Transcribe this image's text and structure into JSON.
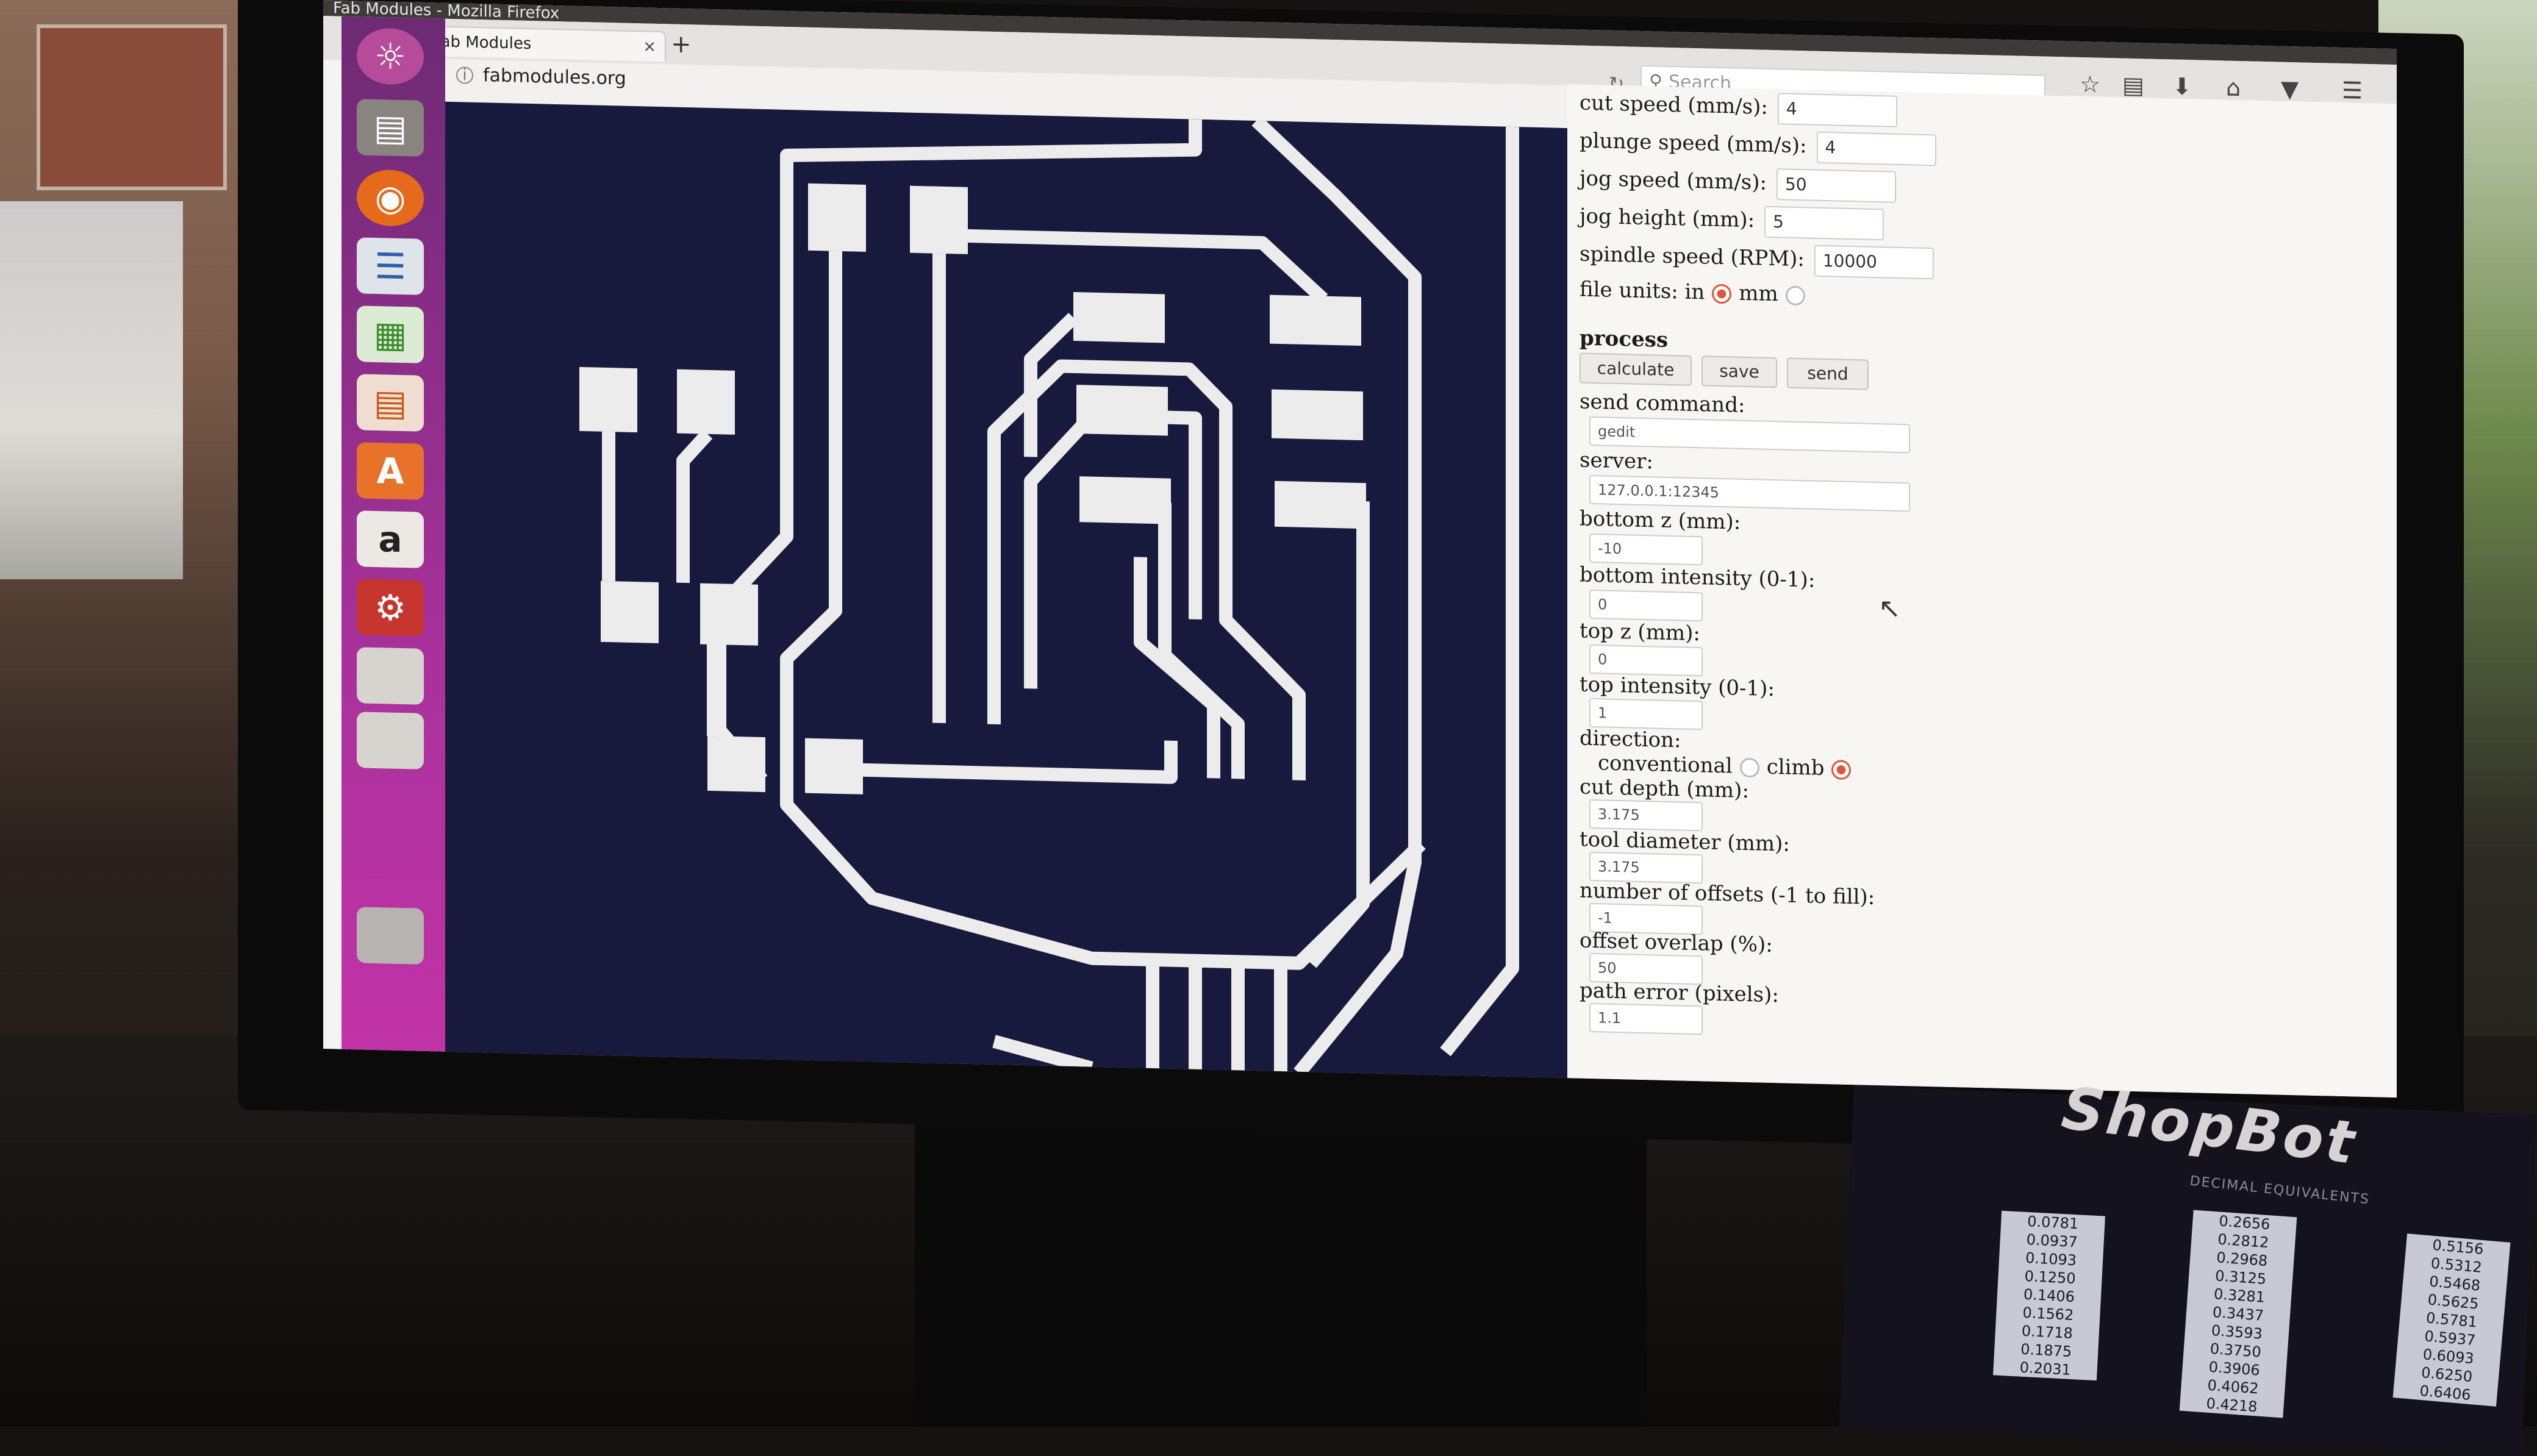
{
  "window": {
    "title_bar": "Fab Modules - Mozilla Firefox",
    "tab_label": "Fab Modules",
    "tab_close": "×",
    "new_tab": "+",
    "url": "fabmodules.org",
    "search_placeholder": "Search"
  },
  "form": {
    "cut_speed_label": "cut speed (mm/s):",
    "cut_speed": "4",
    "plunge_speed_label": "plunge speed (mm/s):",
    "plunge_speed": "4",
    "jog_speed_label": "jog speed (mm/s):",
    "jog_speed": "50",
    "jog_height_label": "jog height (mm):",
    "jog_height": "5",
    "spindle_speed_label": "spindle speed (RPM):",
    "spindle_speed": "10000",
    "file_units_label": "file units: in",
    "file_units_mm": "mm",
    "process_heading": "process",
    "calculate_label": "calculate",
    "save_label": "save",
    "send_label": "send",
    "send_command_label": "send command:",
    "send_command": "gedit",
    "server_label": "server:",
    "server": "127.0.0.1:12345",
    "bottom_z_label": "bottom z (mm):",
    "bottom_z": "-10",
    "bottom_intensity_label": "bottom intensity (0-1):",
    "bottom_intensity": "0",
    "top_z_label": "top z (mm):",
    "top_z": "0",
    "top_intensity_label": "top intensity (0-1):",
    "top_intensity": "1",
    "direction_label": "direction:",
    "conventional_label": "conventional",
    "climb_label": "climb",
    "cut_depth_label": "cut depth (mm):",
    "cut_depth": "3.175",
    "tool_diameter_label": "tool diameter (mm):",
    "tool_diameter": "3.175",
    "offsets_label": "number of offsets (-1 to fill):",
    "offsets": "-1",
    "offset_overlap_label": "offset overlap (%):",
    "offset_overlap": "50",
    "path_error_label": "path error (pixels):",
    "path_error": "1.1"
  },
  "chart": {
    "logo": "ShopBot",
    "subtitle": "DECIMAL EQUIVALENTS",
    "col1": [
      "0.0781",
      "0.0937",
      "0.1093",
      "0.1250",
      "0.1406",
      "0.1562",
      "0.1718",
      "0.1875",
      "0.2031"
    ],
    "col2": [
      "0.2656",
      "0.2812",
      "0.2968",
      "0.3125",
      "0.3281",
      "0.3437",
      "0.3593",
      "0.3750",
      "0.3906",
      "0.4062",
      "0.4218"
    ],
    "col3": [
      "0.5156",
      "0.5312",
      "0.5468",
      "0.5625",
      "0.5781",
      "0.5937",
      "0.6093",
      "0.6250",
      "0.6406"
    ]
  }
}
